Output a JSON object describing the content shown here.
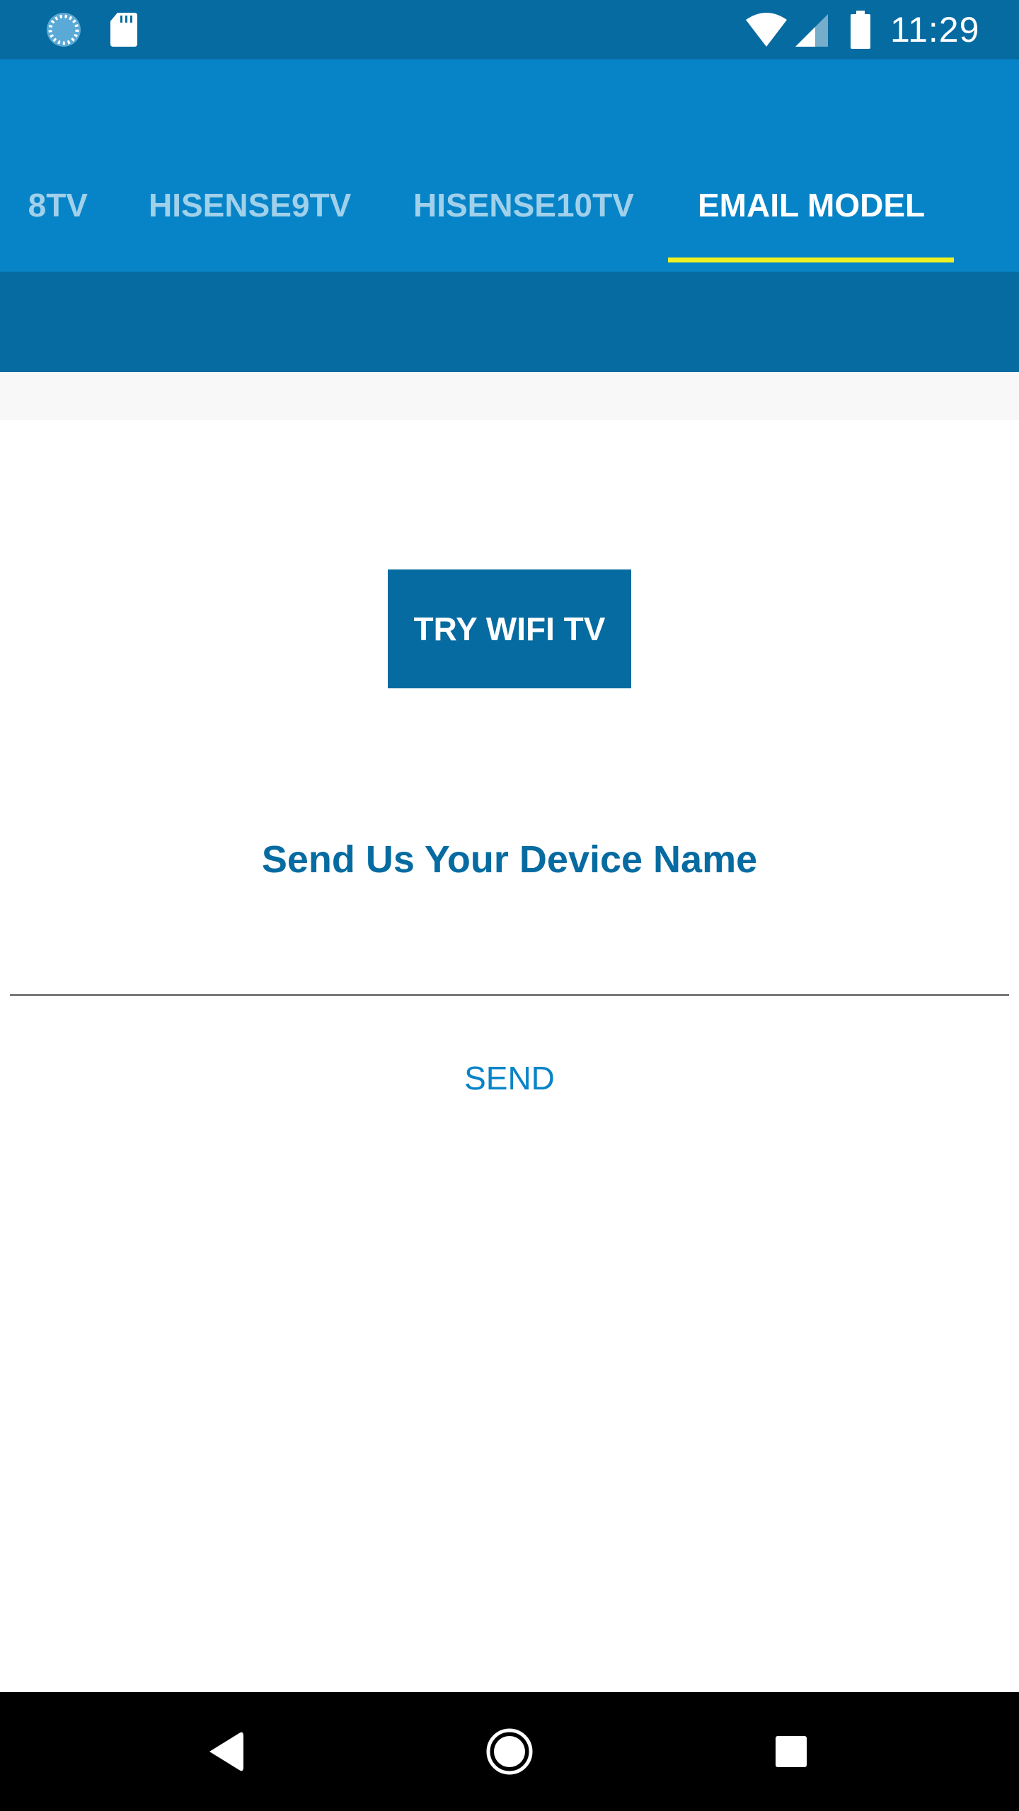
{
  "status_bar": {
    "time": "11:29",
    "icons": [
      "loader-icon",
      "sd-card-icon",
      "wifi-icon",
      "cell-signal-icon",
      "battery-icon"
    ]
  },
  "tabs": [
    {
      "label": "8TV",
      "active": false
    },
    {
      "label": "HISENSE9TV",
      "active": false
    },
    {
      "label": "HISENSE10TV",
      "active": false
    },
    {
      "label": "EMAIL MODEL",
      "active": true
    }
  ],
  "content": {
    "try_wifi_label": "TRY WIFI TV",
    "heading": "Send Us Your Device Name",
    "device_input_value": "",
    "device_input_placeholder": "",
    "send_label": "SEND"
  },
  "nav_bar": {
    "icons": [
      "back-icon",
      "home-icon",
      "recents-icon"
    ]
  },
  "colors": {
    "status_bar": "#066ba1",
    "app_bar": "#0784c8",
    "accent_indicator": "#eef223",
    "button": "#066ba1",
    "heading_text": "#066ba1",
    "send_text": "#0784c8"
  }
}
